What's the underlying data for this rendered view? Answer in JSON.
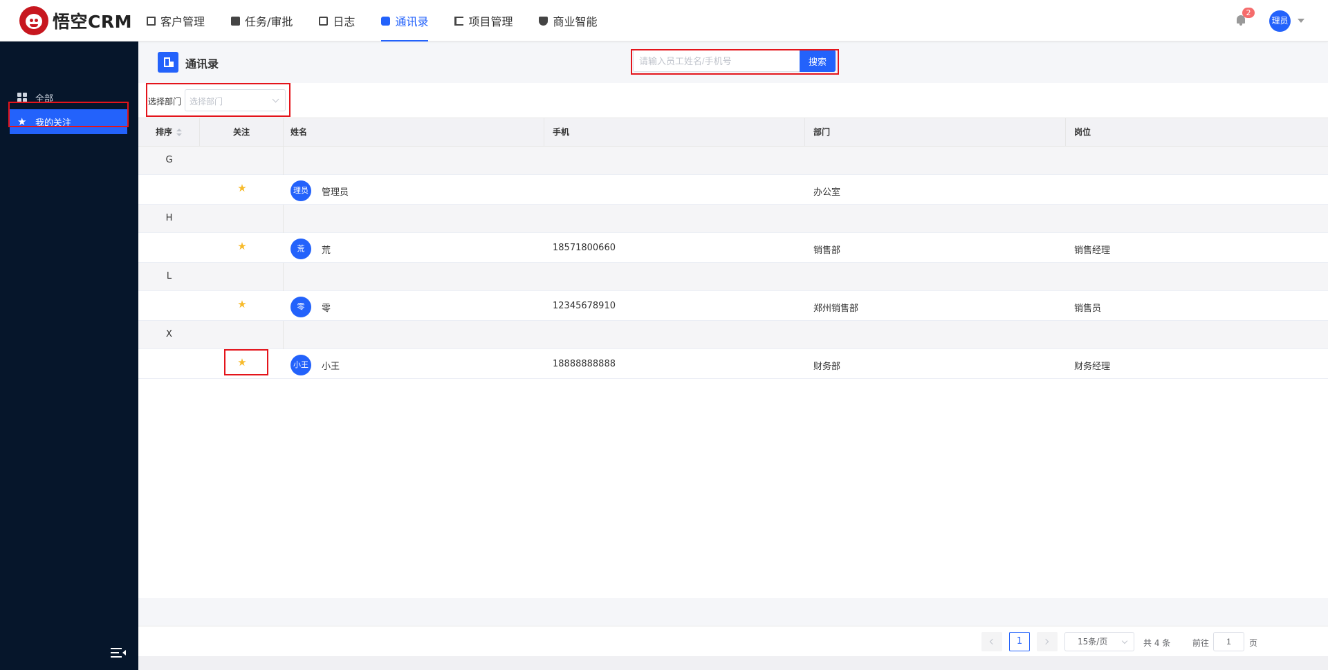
{
  "app": {
    "logo_text": "悟空CRM"
  },
  "nav": {
    "items": [
      {
        "label": "客户管理",
        "icon": "building-icon"
      },
      {
        "label": "任务/审批",
        "icon": "briefcase-icon"
      },
      {
        "label": "日志",
        "icon": "document-icon"
      },
      {
        "label": "通讯录",
        "icon": "phone-book-icon",
        "active": true
      },
      {
        "label": "项目管理",
        "icon": "list-icon"
      },
      {
        "label": "商业智能",
        "icon": "shield-icon"
      }
    ],
    "notification_count": "2",
    "user_avatar": "理员"
  },
  "sidebar": {
    "items": [
      {
        "label": "全部",
        "icon": "grid-icon"
      },
      {
        "label": "我的关注",
        "icon": "star-icon",
        "active": true
      }
    ]
  },
  "header": {
    "title": "通讯录",
    "search_placeholder": "请输入员工姓名/手机号",
    "search_button": "搜索"
  },
  "filter": {
    "label": "选择部门",
    "placeholder": "选择部门"
  },
  "table": {
    "columns": {
      "sort": "排序",
      "follow": "关注",
      "name": "姓名",
      "phone": "手机",
      "dept": "部门",
      "position": "岗位"
    },
    "groups": [
      {
        "letter": "G",
        "rows": [
          {
            "avatar": "理员",
            "name": "管理员",
            "phone": "",
            "dept": "办公室",
            "position": ""
          }
        ]
      },
      {
        "letter": "H",
        "rows": [
          {
            "avatar": "荒",
            "name": "荒",
            "phone": "18571800660",
            "dept": "销售部",
            "position": "销售经理"
          }
        ]
      },
      {
        "letter": "L",
        "rows": [
          {
            "avatar": "零",
            "name": "零",
            "phone": "12345678910",
            "dept": "郑州销售部",
            "position": "销售员"
          }
        ]
      },
      {
        "letter": "X",
        "rows": [
          {
            "avatar": "小王",
            "name": "小王",
            "phone": "18888888888",
            "dept": "财务部",
            "position": "财务经理"
          }
        ]
      }
    ]
  },
  "pagination": {
    "current_page": "1",
    "page_size": "15条/页",
    "total": "共 4 条",
    "goto_prefix": "前往",
    "goto_value": "1",
    "goto_suffix": "页"
  },
  "colors": {
    "accent": "#2362fb",
    "sidebar_bg": "#06162b",
    "star": "#f7ba2a",
    "highlight_box": "#e4141b"
  }
}
